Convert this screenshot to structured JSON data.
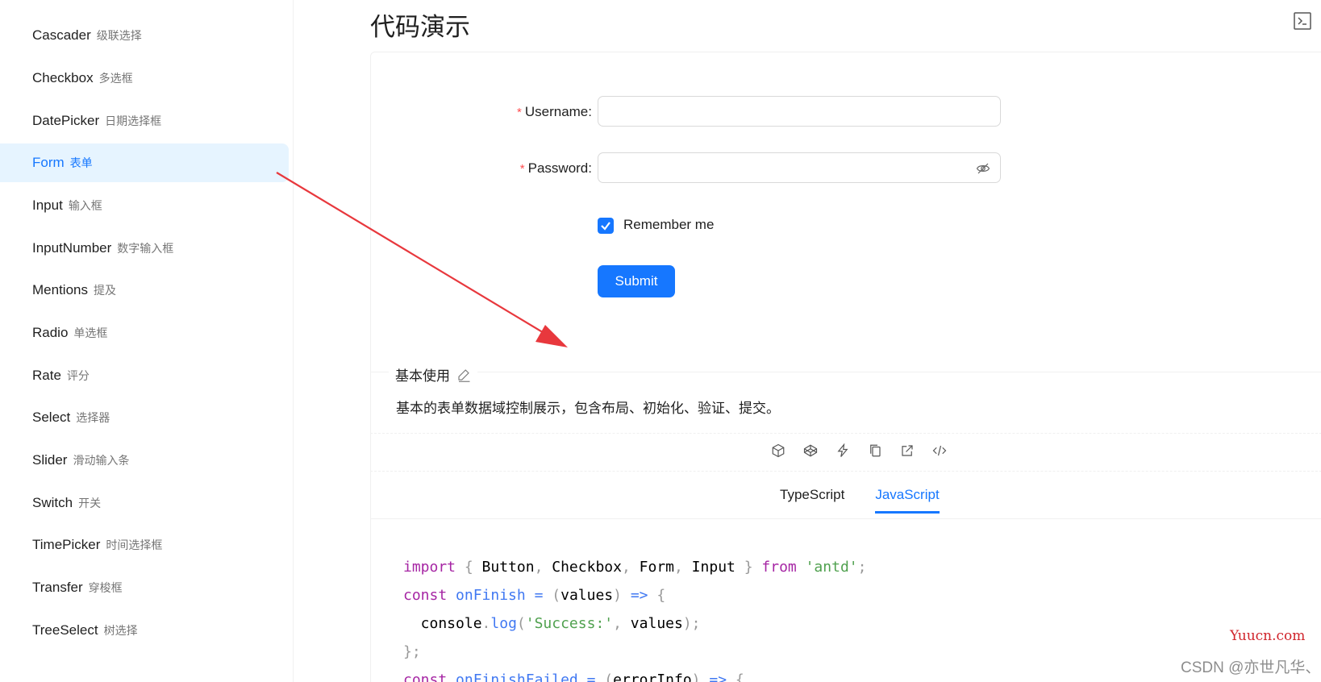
{
  "sidebar": {
    "items": [
      {
        "en": "Cascader",
        "zh": "级联选择"
      },
      {
        "en": "Checkbox",
        "zh": "多选框"
      },
      {
        "en": "DatePicker",
        "zh": "日期选择框"
      },
      {
        "en": "Form",
        "zh": "表单"
      },
      {
        "en": "Input",
        "zh": "输入框"
      },
      {
        "en": "InputNumber",
        "zh": "数字输入框"
      },
      {
        "en": "Mentions",
        "zh": "提及"
      },
      {
        "en": "Radio",
        "zh": "单选框"
      },
      {
        "en": "Rate",
        "zh": "评分"
      },
      {
        "en": "Select",
        "zh": "选择器"
      },
      {
        "en": "Slider",
        "zh": "滑动输入条"
      },
      {
        "en": "Switch",
        "zh": "开关"
      },
      {
        "en": "TimePicker",
        "zh": "时间选择框"
      },
      {
        "en": "Transfer",
        "zh": "穿梭框"
      },
      {
        "en": "TreeSelect",
        "zh": "树选择"
      }
    ],
    "active_item": "Form"
  },
  "header": {
    "title": "代码演示",
    "icon": "terminal-icon"
  },
  "form": {
    "username_label": "Username",
    "password_label": "Password",
    "required_mark": "*",
    "label_colon": ":",
    "username_value": "",
    "password_value": "",
    "remember_label": "Remember me",
    "remember_checked": true,
    "submit_label": "Submit"
  },
  "demo": {
    "section_title": "基本使用",
    "description": "基本的表单数据域控制展示，包含布局、初始化、验证、提交。",
    "action_icons": [
      "codesandbox-icon",
      "codepen-icon",
      "stackblitz-icon",
      "copy-icon",
      "open-external-icon",
      "code-icon"
    ],
    "tabs": [
      "TypeScript",
      "JavaScript"
    ],
    "active_tab": "JavaScript"
  },
  "code": {
    "lines": [
      "import { Button, Checkbox, Form, Input } from 'antd';",
      "const onFinish = (values) => {",
      "  console.log('Success:', values);",
      "};",
      "const onFinishFailed = (errorInfo) => {"
    ]
  },
  "watermark": {
    "site": "Yuucn.com",
    "author": "CSDN @亦世凡华、"
  },
  "colors": {
    "primary": "#1677ff",
    "active_bg": "#e6f4ff",
    "required": "#ff4d4f",
    "arrow": "#e8383d"
  }
}
